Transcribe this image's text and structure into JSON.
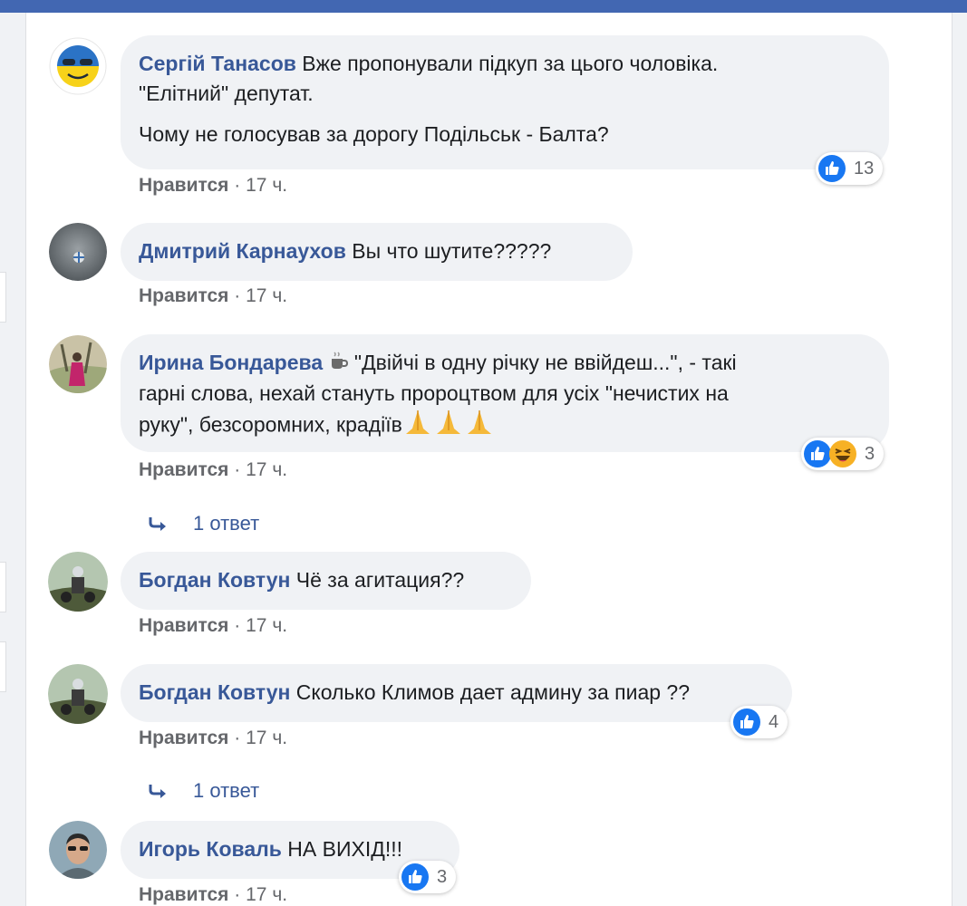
{
  "comments": [
    {
      "author": "Сергій Танасов",
      "text_line1": "Вже пропонували підкуп за цього чоловіка.",
      "text_line2": "\"Елітний\" депутат.",
      "text_para2": "Чому не голосував за дорогу Подільськ - Балта?",
      "like_label": "Нравится",
      "separator": "·",
      "time": "17 ч.",
      "reactions": {
        "count": "13",
        "types": [
          "like"
        ]
      }
    },
    {
      "author": "Дмитрий Карнаухов",
      "text": "Вы что шутите?????",
      "like_label": "Нравится",
      "separator": "·",
      "time": "17 ч."
    },
    {
      "author": "Ирина Бондарева",
      "text_line1": "\"Двійчі в одну річку не ввійдеш...\", - такі",
      "text_line2": "гарні слова, нехай стануть пророцтвом для усіх \"нечистих на",
      "text_line3": "руку\", безсоромних, крадіїв",
      "emoji_prefix": "hot-beverage",
      "emoji_suffix": [
        "folded-hands",
        "folded-hands",
        "folded-hands"
      ],
      "like_label": "Нравится",
      "separator": "·",
      "time": "17 ч.",
      "reactions": {
        "count": "3",
        "types": [
          "like",
          "haha"
        ]
      },
      "replies_label": "1 ответ"
    },
    {
      "author": "Богдан Ковтун",
      "text": "Чё за агитация??",
      "like_label": "Нравится",
      "separator": "·",
      "time": "17 ч."
    },
    {
      "author": "Богдан Ковтун",
      "text": "Сколько Климов дает админу за пиар ??",
      "like_label": "Нравится",
      "separator": "·",
      "time": "17 ч.",
      "reactions": {
        "count": "4",
        "types": [
          "like"
        ]
      },
      "replies_label": "1 ответ"
    },
    {
      "author": "Игорь Коваль",
      "text": "НА ВИХІД!!!",
      "like_label": "Нравится",
      "separator": "·",
      "time": "17 ч.",
      "reactions": {
        "count": "3",
        "types": [
          "like"
        ]
      }
    }
  ],
  "colors": {
    "author": "#385898",
    "bubble": "#f0f2f5",
    "meta": "#65676b",
    "like_blue": "#1877f2",
    "topbar": "#4267b2"
  }
}
